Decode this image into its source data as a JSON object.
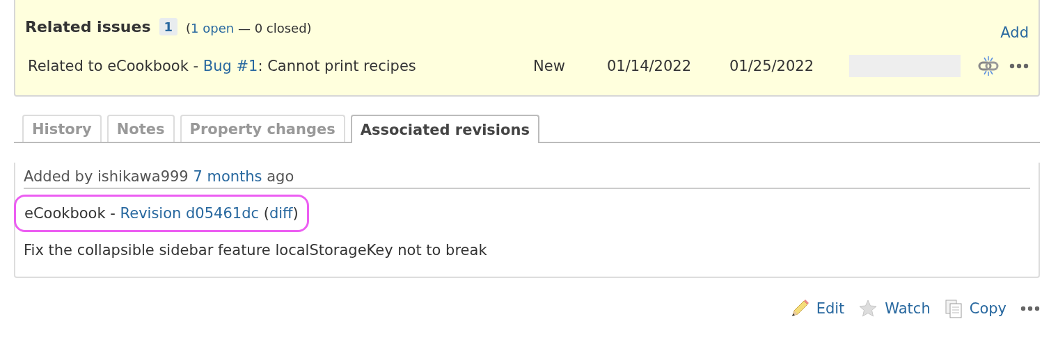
{
  "related_issues": {
    "title": "Related issues",
    "count": "1",
    "open_prefix": "(",
    "open_link": "1 open",
    "closed_text": " — 0 closed)",
    "add": "Add",
    "rows": [
      {
        "prefix": "Related to eCookbook - ",
        "link": "Bug #1",
        "suffix": ": Cannot print recipes",
        "status": "New",
        "start_date": "01/14/2022",
        "due_date": "01/25/2022",
        "level": 0
      }
    ]
  },
  "tabs": [
    {
      "label": "History",
      "selected": false
    },
    {
      "label": "Notes",
      "selected": false
    },
    {
      "label": "Property changes",
      "selected": false
    },
    {
      "label": "Associated revisions",
      "selected": true
    }
  ],
  "revision": {
    "added_prefix": "Added by ishikawa999 ",
    "added_link": "7 months",
    "added_suffix": " ago",
    "project": "eCookbook - ",
    "revision_link": "Revision d05461dc",
    "diff_open": "(",
    "diff_link": "diff",
    "diff_close": ")",
    "highlighted": true,
    "message": "Fix the collapsible sidebar feature localStorageKey not to break"
  },
  "actions": [
    {
      "kind": "edit",
      "label": "Edit"
    },
    {
      "kind": "watch",
      "label": "Watch"
    },
    {
      "kind": "copy",
      "label": "Copy"
    },
    {
      "kind": "more"
    }
  ]
}
